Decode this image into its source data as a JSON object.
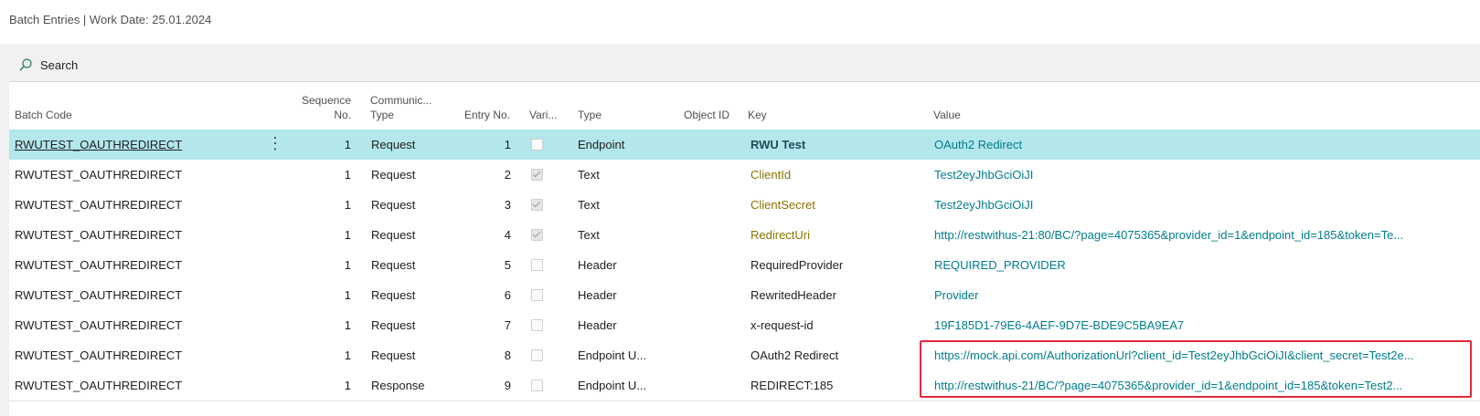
{
  "header": {
    "title": "Batch Entries | Work Date: 25.01.2024"
  },
  "toolbar": {
    "search_label": "Search",
    "search_icon": "search-icon"
  },
  "columns": {
    "batch_code": "Batch Code",
    "sequence_no_1": "Sequence",
    "sequence_no_2": "No.",
    "comm_type_1": "Communic...",
    "comm_type_2": "Type",
    "entry_no": "Entry No.",
    "variable": "Vari...",
    "type": "Type",
    "object_id": "Object ID",
    "key": "Key",
    "value": "Value"
  },
  "colors": {
    "selected_row": "#b3e7ec",
    "link_value": "#007d8a",
    "key_highlight": "#8a7400",
    "highlight_box": "#e0283c"
  },
  "rows": [
    {
      "batch_code": "RWUTEST_OAUTHREDIRECT",
      "sequence_no": "1",
      "comm_type": "Request",
      "entry_no": "1",
      "variable": false,
      "type": "Endpoint",
      "object_id": "",
      "key": "RWU Test",
      "value": "OAuth2 Redirect"
    },
    {
      "batch_code": "RWUTEST_OAUTHREDIRECT",
      "sequence_no": "1",
      "comm_type": "Request",
      "entry_no": "2",
      "variable": true,
      "type": "Text",
      "object_id": "",
      "key": "ClientId",
      "value": "Test2eyJhbGciOiJI"
    },
    {
      "batch_code": "RWUTEST_OAUTHREDIRECT",
      "sequence_no": "1",
      "comm_type": "Request",
      "entry_no": "3",
      "variable": true,
      "type": "Text",
      "object_id": "",
      "key": "ClientSecret",
      "value": "Test2eyJhbGciOiJI"
    },
    {
      "batch_code": "RWUTEST_OAUTHREDIRECT",
      "sequence_no": "1",
      "comm_type": "Request",
      "entry_no": "4",
      "variable": true,
      "type": "Text",
      "object_id": "",
      "key": "RedirectUri",
      "value": "http://restwithus-21:80/BC/?page=4075365&provider_id=1&endpoint_id=185&token=Te..."
    },
    {
      "batch_code": "RWUTEST_OAUTHREDIRECT",
      "sequence_no": "1",
      "comm_type": "Request",
      "entry_no": "5",
      "variable": false,
      "type": "Header",
      "object_id": "",
      "key": "RequiredProvider",
      "value": "REQUIRED_PROVIDER"
    },
    {
      "batch_code": "RWUTEST_OAUTHREDIRECT",
      "sequence_no": "1",
      "comm_type": "Request",
      "entry_no": "6",
      "variable": false,
      "type": "Header",
      "object_id": "",
      "key": "RewritedHeader",
      "value": "Provider"
    },
    {
      "batch_code": "RWUTEST_OAUTHREDIRECT",
      "sequence_no": "1",
      "comm_type": "Request",
      "entry_no": "7",
      "variable": false,
      "type": "Header",
      "object_id": "",
      "key": "x-request-id",
      "value": "19F185D1-79E6-4AEF-9D7E-BDE9C5BA9EA7"
    },
    {
      "batch_code": "RWUTEST_OAUTHREDIRECT",
      "sequence_no": "1",
      "comm_type": "Request",
      "entry_no": "8",
      "variable": false,
      "type": "Endpoint U...",
      "object_id": "",
      "key": "OAuth2 Redirect",
      "value": "https://mock.api.com/AuthorizationUrl?client_id=Test2eyJhbGciOiJI&client_secret=Test2e..."
    },
    {
      "batch_code": "RWUTEST_OAUTHREDIRECT",
      "sequence_no": "1",
      "comm_type": "Response",
      "entry_no": "9",
      "variable": false,
      "type": "Endpoint U...",
      "object_id": "",
      "key": "REDIRECT:185",
      "value": "http://restwithus-21/BC/?page=4075365&provider_id=1&endpoint_id=185&token=Test2..."
    }
  ]
}
